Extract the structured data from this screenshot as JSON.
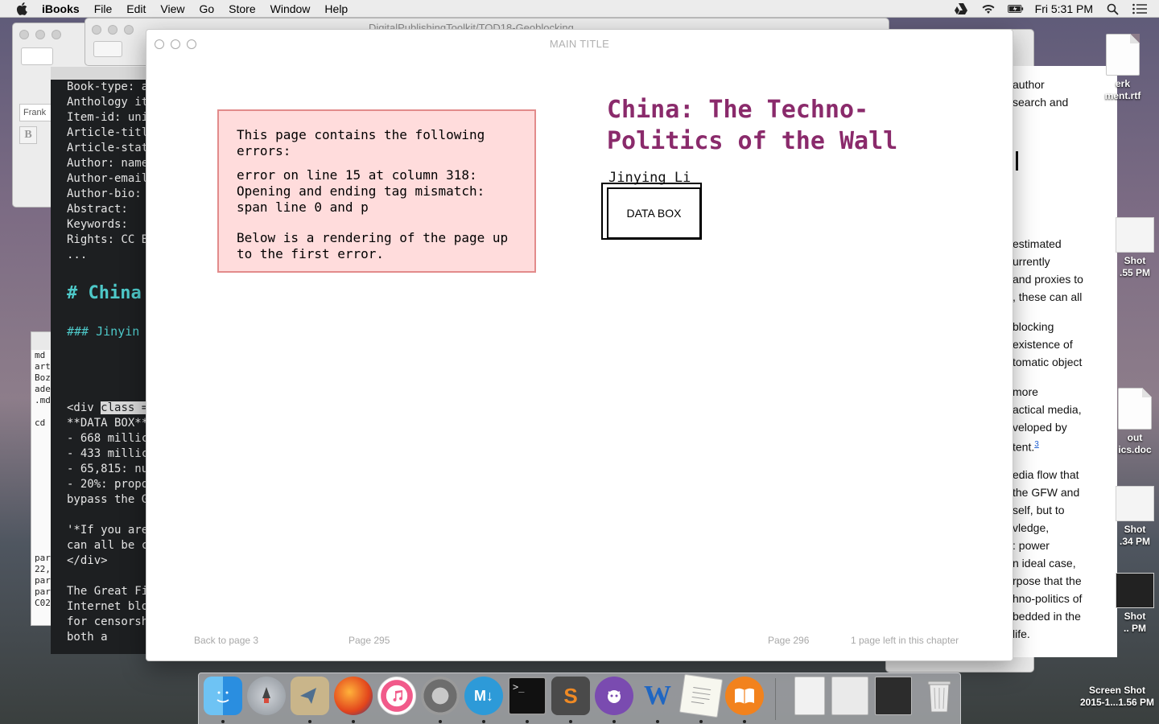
{
  "menubar": {
    "app": "iBooks",
    "items": [
      "File",
      "Edit",
      "View",
      "Go",
      "Store",
      "Window",
      "Help"
    ],
    "clock": "Fri 5:31 PM"
  },
  "background_window": {
    "title": "DigitalPublishingToolkit/TOD18-Geoblocking",
    "font_field": "Frank"
  },
  "editor": {
    "lines": [
      "Book-type: a",
      "Anthology it",
      "Item-id: uni",
      "Article-titl",
      "Article-stat",
      "Author: name",
      "Author-email",
      "Author-bio: ",
      "Abstract: ",
      "Keywords: ",
      "Rights: CC B",
      "..."
    ],
    "heading1": "# China",
    "heading3": "### Jinyin",
    "div_open_a": "<div ",
    "div_open_sel": "class =",
    "body_lines": [
      "**DATA BOX**",
      "- 668 millic",
      "- 433 millic",
      "- 65,815: nu",
      "- 20%: propo",
      "bypass the G"
    ],
    "quote_lines": [
      "'*If you are",
      "can all be c",
      "</div>"
    ],
    "tail_lines": [
      "The Great Fi",
      "Internet blo",
      "for censorsh",
      "both a"
    ]
  },
  "terminal": {
    "lines_top": [
      "md",
      "art",
      "Boz",
      "ade",
      ".md"
    ],
    "line_cd": "cd",
    "lines_bottom": [
      "par",
      "22,",
      "par",
      "par",
      "C02"
    ]
  },
  "right_doc": {
    "top_lines": [
      "author",
      "search and"
    ],
    "para1": [
      "estimated",
      "urrently",
      "and proxies to",
      ", these can all"
    ],
    "para2": [
      "blocking",
      "existence of",
      "tomatic object"
    ],
    "para3": [
      "more",
      "actical media,",
      "veloped by",
      "tent."
    ],
    "para3_footnote": "3",
    "para4": [
      "edia flow that",
      " the GFW and",
      "self, but to",
      "vledge,",
      ": power",
      "n ideal case,",
      "rpose that the",
      "hno-politics of",
      "bedded in the",
      " life."
    ]
  },
  "desktop_icons": [
    {
      "label": "erk\nment.rtf"
    },
    {
      "label": "Shot\n.55 PM"
    },
    {
      "label": "out\nics.doc"
    },
    {
      "label": "Shot\n.34 PM"
    },
    {
      "label": "Shot\n.. PM"
    },
    {
      "label": "Screen Shot\n2015-1...1.56 PM"
    }
  ],
  "ibooks": {
    "window_title": "MAIN TITLE",
    "error": {
      "heading": "This page contains the following errors:",
      "detail": "error on line 15 at column 318: Opening and ending tag mismatch: span line 0 and p",
      "note": "Below is a rendering of the page up to the first error."
    },
    "article_title": "China: The Techno-Politics of the Wall",
    "author": "Jinying Li",
    "data_box": "DATA BOX",
    "footer": {
      "back": "Back to page 3",
      "page_left": "Page 295",
      "page_right": "Page 296",
      "remaining": "1 page left in this chapter"
    }
  },
  "dock_items": [
    "Finder",
    "Launchpad",
    "Mail",
    "Firefox",
    "iTunes",
    "System Preferences",
    "MacDown",
    "Terminal",
    "Sublime Text",
    "GitHub",
    "Word",
    "TextEdit",
    "iBooks",
    "Documents",
    "Recent",
    "Downloads",
    "Trash"
  ]
}
